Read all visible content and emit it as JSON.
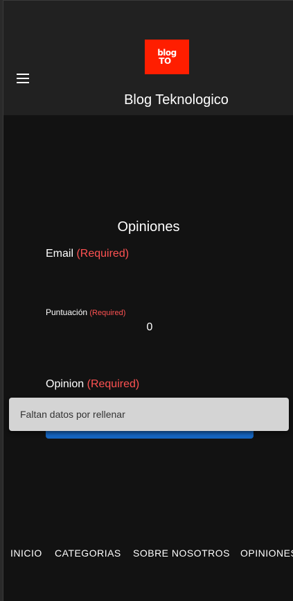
{
  "header": {
    "logo_line1": "blog",
    "logo_line2": "TO",
    "site_title": "Blog Teknologico",
    "menu_icon": "hamburger-menu-icon"
  },
  "form": {
    "title": "Opiniones",
    "email_label": "Email",
    "email_required": "(Required)",
    "score_label": "Puntuación",
    "score_required": "(Required)",
    "score_value": "0",
    "opinion_label": "Opinion",
    "opinion_required": "(Required)"
  },
  "snackbar": {
    "message": "Faltan datos por rellenar"
  },
  "bottom_nav": {
    "items": [
      {
        "label": "INICIO"
      },
      {
        "label": "CATEGORIAS"
      },
      {
        "label": "SOBRE NOSOTROS"
      },
      {
        "label": "OPINIONES"
      }
    ]
  },
  "colors": {
    "background": "#121212",
    "appbar": "#212121",
    "logo_bg": "#ff1e00",
    "required": "#ff5252",
    "button": "#1565c0",
    "snackbar": "#d4d4d4"
  }
}
